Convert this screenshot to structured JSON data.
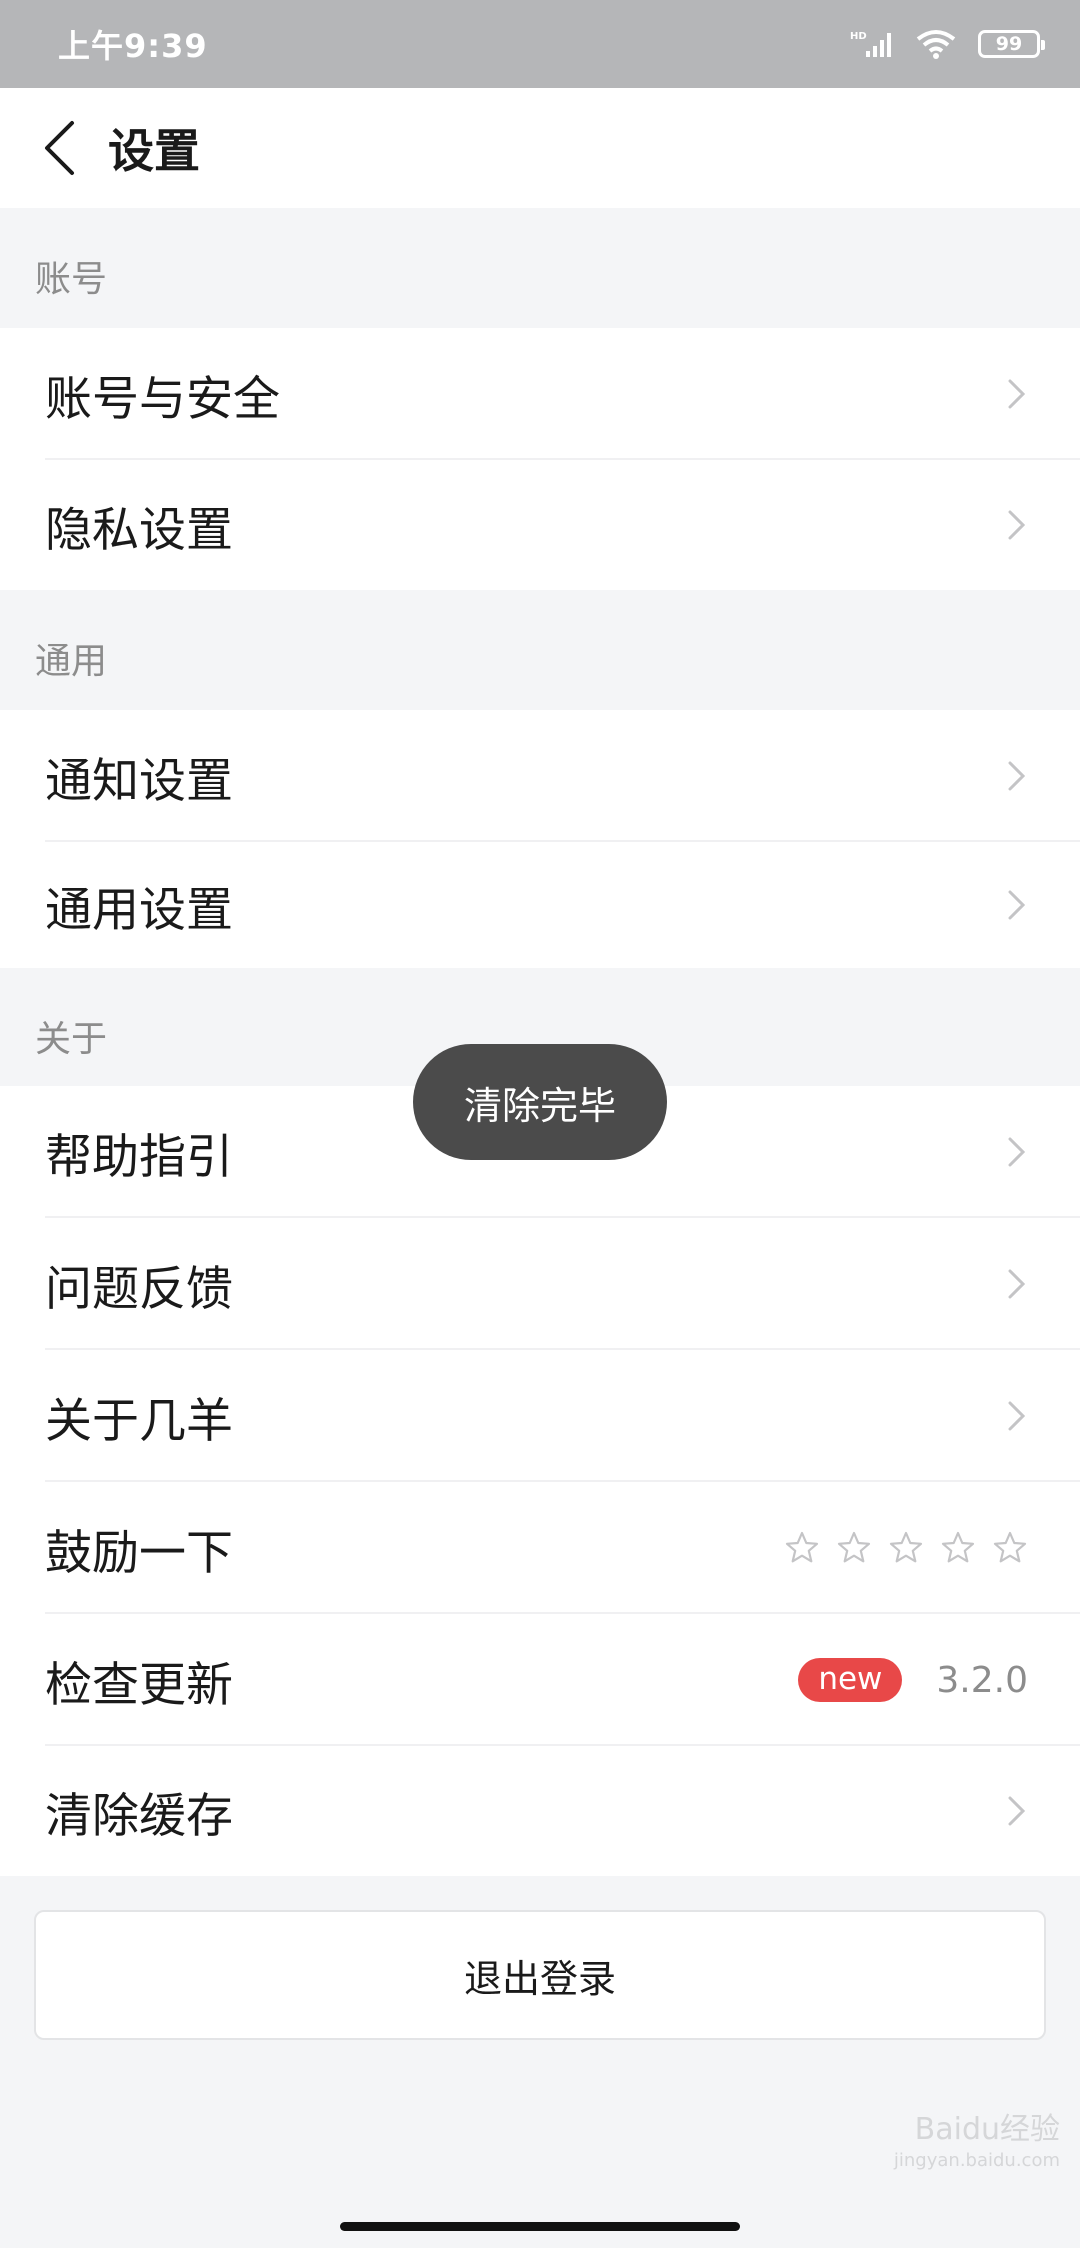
{
  "status_bar": {
    "time": "上午9:39",
    "battery": "99",
    "icons": [
      "hd-signal-icon",
      "wifi-icon",
      "battery-icon"
    ]
  },
  "header": {
    "title": "设置",
    "back_icon": "chevron-left-icon"
  },
  "sections": {
    "account": {
      "label": "账号",
      "items": [
        {
          "label": "账号与安全"
        },
        {
          "label": "隐私设置"
        }
      ]
    },
    "general": {
      "label": "通用",
      "items": [
        {
          "label": "通知设置"
        },
        {
          "label": "通用设置"
        }
      ]
    },
    "about": {
      "label": "关于",
      "items": [
        {
          "label": "帮助指引"
        },
        {
          "label": "问题反馈"
        },
        {
          "label": "关于几羊"
        },
        {
          "label": "鼓励一下",
          "rating": 0,
          "rating_max": 5
        },
        {
          "label": "检查更新",
          "badge": "new",
          "version": "3.2.0"
        },
        {
          "label": "清除缓存"
        }
      ]
    }
  },
  "logout": {
    "label": "退出登录"
  },
  "toast": {
    "text": "清除完毕"
  },
  "watermark": {
    "text": "Baidu经验",
    "sub": "jingyan.baidu.com"
  },
  "colors": {
    "status_bar": "#b5b6b8",
    "background": "#f4f5f7",
    "badge": "#e84848",
    "toast": "#4b4b4b"
  }
}
